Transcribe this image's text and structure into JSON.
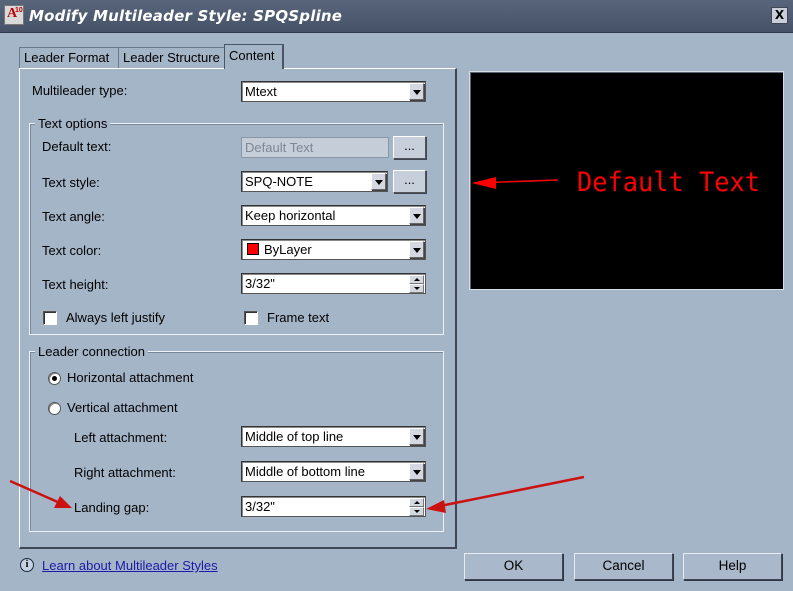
{
  "window": {
    "title": "Modify Multileader Style: SPQSpline",
    "close_glyph": "X",
    "icon_text": "A",
    "icon_badge": "10"
  },
  "tabs": [
    {
      "label": "Leader Format"
    },
    {
      "label": "Leader Structure"
    },
    {
      "label": "Content"
    }
  ],
  "content": {
    "multileader_type_label": "Multileader type:",
    "multileader_type_value": "Mtext",
    "text_options": {
      "title": "Text options",
      "default_text_label": "Default text:",
      "default_text_value": "Default Text",
      "text_style_label": "Text style:",
      "text_style_value": "SPQ-NOTE",
      "text_angle_label": "Text angle:",
      "text_angle_value": "Keep horizontal",
      "text_color_label": "Text color:",
      "text_color_value": "ByLayer",
      "text_height_label": "Text height:",
      "text_height_value": "3/32\"",
      "always_left_justify_label": "Always left justify",
      "frame_text_label": "Frame text",
      "browse_label": "..."
    },
    "leader_connection": {
      "title": "Leader connection",
      "horizontal_label": "Horizontal attachment",
      "vertical_label": "Vertical attachment",
      "left_attachment_label": "Left attachment:",
      "left_attachment_value": "Middle of top line",
      "right_attachment_label": "Right attachment:",
      "right_attachment_value": "Middle of bottom line",
      "landing_gap_label": "Landing gap:",
      "landing_gap_value": "3/32\""
    }
  },
  "preview": {
    "text": "Default Text"
  },
  "footer": {
    "info_glyph": "i",
    "learn_link": "Learn about Multileader Styles",
    "ok": "OK",
    "cancel": "Cancel",
    "help": "Help"
  },
  "colors": {
    "dialog_bg": "#a5b5c8",
    "preview_bg": "#000000",
    "preview_text": "#ff0000",
    "swatch_bylayer": "#ff0000",
    "annotation_arrow": "#cc1111",
    "link": "#1b1ba8"
  },
  "icons": [
    "app-icon",
    "close-icon",
    "dropdown-arrow-icon",
    "spinner-icon",
    "info-icon",
    "annotation-arrow-icon"
  ]
}
